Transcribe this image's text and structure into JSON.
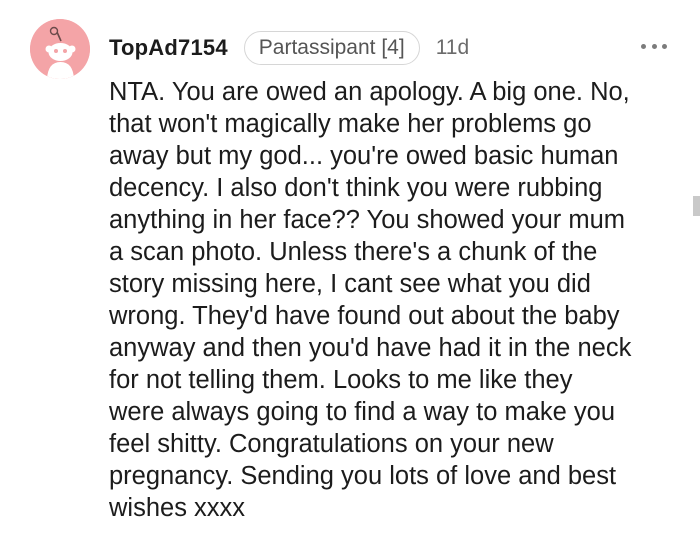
{
  "comment": {
    "author": "TopAd7154",
    "flair": "Partassipant [4]",
    "time": "11d",
    "body": "NTA. You are owed an apology. A big one. No,\nthat won't magically make her problems go\naway but my god... you're owed basic human\ndecency. I also don't think you were rubbing\nanything in her face?? You showed your mum\na scan photo. Unless there's a chunk of the\nstory missing here, I cant see what you did\nwrong. They'd have found out about the baby\nanyway and then you'd have had it in the neck\nfor not telling them. Looks to me like they\nwere always going to find a way to make you\nfeel shitty. Congratulations on your new\npregnancy. Sending you lots of love and best\nwishes xxxx",
    "avatar_color": "#f4a4a7",
    "more_icon": "more-options-icon"
  }
}
